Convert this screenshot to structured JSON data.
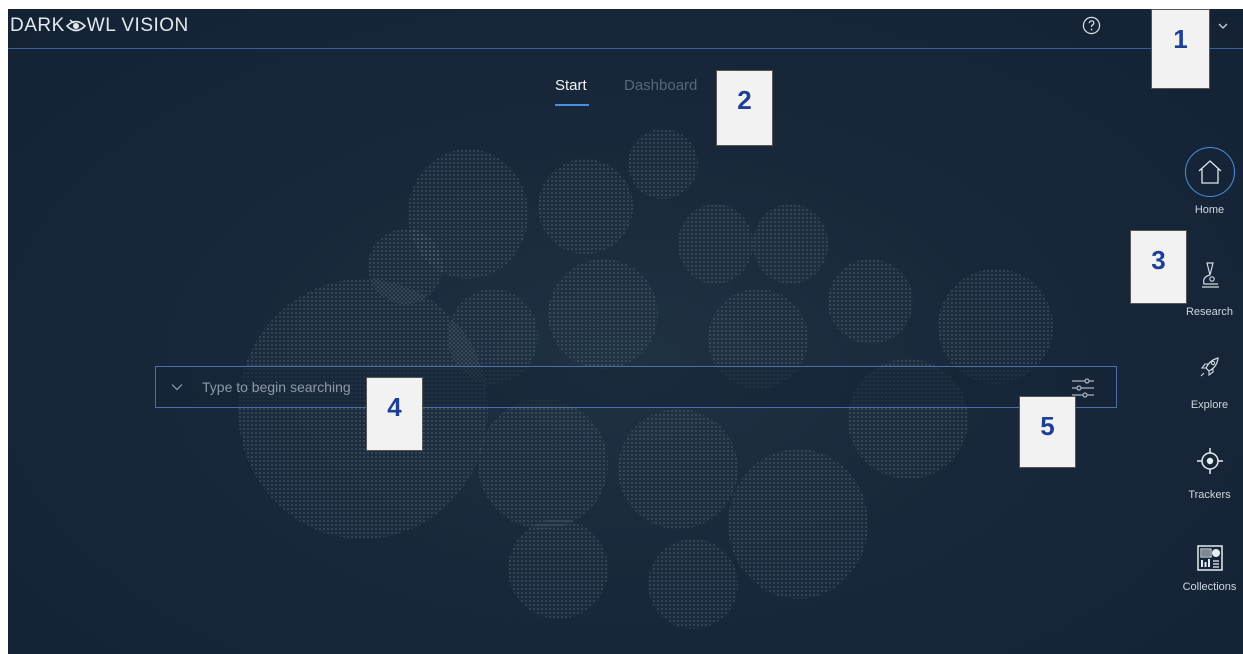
{
  "header": {
    "logo_left": "DARK",
    "logo_right": "WL VISION",
    "help_icon": "help-circle-icon",
    "user_menu_icon": "chevron-down-icon"
  },
  "tabs": [
    {
      "label": "Start",
      "active": true
    },
    {
      "label": "Dashboard",
      "active": false
    }
  ],
  "search": {
    "placeholder": "Type to begin searching",
    "value": "",
    "expand_icon": "chevron-down-icon",
    "filter_icon": "sliders-icon"
  },
  "sidenav": [
    {
      "label": "Home",
      "icon": "home-icon",
      "active": true
    },
    {
      "label": "Research",
      "icon": "microscope-icon",
      "active": false
    },
    {
      "label": "Explore",
      "icon": "rocket-icon",
      "active": false
    },
    {
      "label": "Trackers",
      "icon": "crosshair-icon",
      "active": false
    },
    {
      "label": "Collections",
      "icon": "collections-icon",
      "active": false
    }
  ],
  "callouts": [
    "1",
    "2",
    "3",
    "4",
    "5"
  ],
  "colors": {
    "background": "#18283a",
    "accent": "#4a90e2",
    "border": "#3b5f9a",
    "callout_text": "#1f3f95"
  }
}
